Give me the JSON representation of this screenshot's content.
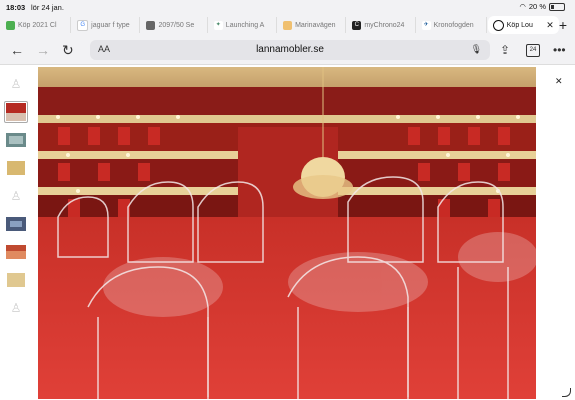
{
  "status": {
    "time": "18:03",
    "date": "lör 24 jan.",
    "battery": "20 %"
  },
  "tabs": [
    {
      "label": "Köp 2021 Cl",
      "favicon": "green-square-icon",
      "color": "#e04a3a"
    },
    {
      "label": "jaguar f type",
      "favicon": "google-icon",
      "color": "#4285f4"
    },
    {
      "label": "2097/50 Se",
      "favicon": "site-icon",
      "color": "#555"
    },
    {
      "label": "Launching A",
      "favicon": "star-icon",
      "color": "#4a8a6a"
    },
    {
      "label": "Marinavägen",
      "favicon": "face-icon",
      "color": "#e0a040"
    },
    {
      "label": "myChrono24",
      "favicon": "c-icon",
      "color": "#222"
    },
    {
      "label": "Kronofogden",
      "favicon": "bird-icon",
      "color": "#1a5a9a"
    },
    {
      "label": "Köp Lou",
      "favicon": "globe-icon",
      "color": "#111",
      "active": true
    }
  ],
  "toolbar": {
    "url": "lannamobler.se",
    "aa": "AA",
    "tab_count": "24"
  },
  "thumbnails": [
    "chair",
    "theater",
    "room",
    "gold-chairs",
    "chair",
    "room2",
    "theater2",
    "gold-chairs",
    "chair"
  ],
  "colors": {
    "accent": "#c0202a",
    "chrome": "#f2f2f4"
  }
}
